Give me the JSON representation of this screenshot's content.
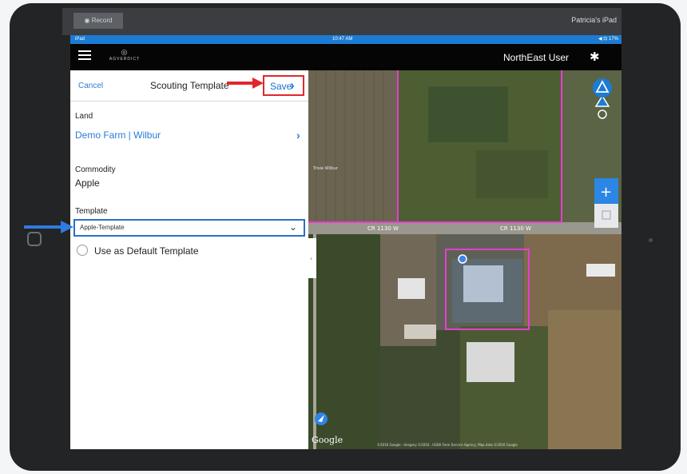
{
  "recorder": {
    "record_label": "◉ Record",
    "device_name": "Patricia's iPad"
  },
  "status_bar": {
    "carrier": "iPad",
    "time": "10:47 AM",
    "right": "◀ ⊡ 17%"
  },
  "app_bar": {
    "logo_text": "AGVERDICT",
    "user_name": "NorthEast User"
  },
  "panel": {
    "cancel_label": "Cancel",
    "title": "Scouting Template",
    "save_label": "Save",
    "land_label": "Land",
    "land_value": "Demo Farm | Wilbur",
    "commodity_label": "Commodity",
    "commodity_value": "Apple",
    "template_label": "Template",
    "template_value": "Apple-Template",
    "default_template_label": "Use as Default Template"
  },
  "map": {
    "field_label": "Trixie Wilbur",
    "road_label_1": "CR 1130 W",
    "road_label_2": "CR 1130 W",
    "attribution": "Google",
    "copyright": "©2016 Google · Imagery ©2016 , USDA Farm Service Agency, Map data ©2016 Google"
  },
  "colors": {
    "accent": "#1c7bd4",
    "highlight_box": "#e0282c",
    "field_boundary": "#e53fd0"
  }
}
